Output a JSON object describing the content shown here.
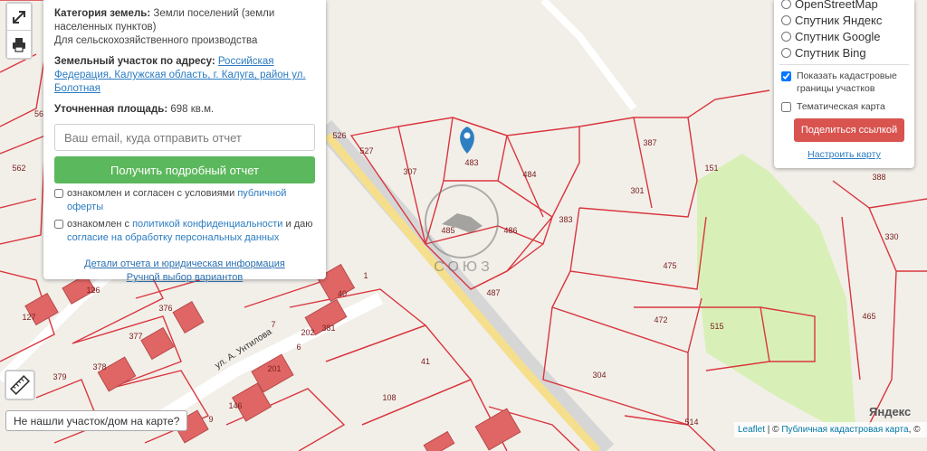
{
  "colors": {
    "parcel_stroke": "#d9363e",
    "building_fill": "#e06666",
    "road_yellow": "#f6df8c",
    "road_grey": "#d6d6d6",
    "green_zone": "#d8f0b8",
    "marker": "#2e7fc2",
    "accent_green": "#5cb85c",
    "accent_red": "#d9534f",
    "link": "#2a7bc1"
  },
  "map_controls": {
    "fullscreen_icon": "expand-icon",
    "print_icon": "printer-icon",
    "ruler_icon": "ruler-icon"
  },
  "info_panel": {
    "category_label": "Категория земель:",
    "category_value": "Земли поселений (земли населенных пунктов)",
    "usage_value": "Для сельскохозяйственного производства",
    "address_label": "Земельный участок по адресу:",
    "address_value": "Российская Федерация, Калужская область, г. Калуга, район ул. Болотная",
    "area_label": "Уточненная площадь:",
    "area_value": "698 кв.м.",
    "email_placeholder": "Ваш email, куда отправить отчет",
    "report_button": "Получить подробный отчет",
    "offer_prefix": "ознакомлен и согласен с условиями",
    "offer_link": "публичной оферты",
    "privacy_prefix": "ознакомлен с",
    "privacy_link": "политикой конфиденциальности",
    "privacy_middle": "и даю",
    "consent_link": "согласие на обработку персональных данных",
    "details_link": "Детали отчета и юридическая информация",
    "manual_link": "Ручной выбор вариантов"
  },
  "layers_panel": {
    "options": [
      {
        "label": "OpenStreetMap",
        "selected": false
      },
      {
        "label": "Спутник Яндекс",
        "selected": false
      },
      {
        "label": "Спутник Google",
        "selected": false
      },
      {
        "label": "Спутник Bing",
        "selected": false
      }
    ],
    "show_boundaries_label": "Показать кадастровые границы участков",
    "show_boundaries_checked": true,
    "thematic_label": "Тематическая карта",
    "thematic_checked": false,
    "share_button": "Поделиться ссылкой",
    "setup_link": "Настроить карту"
  },
  "map": {
    "street_label": "ул. А. Унтилова",
    "watermark_text": "СОЮЗ",
    "parcel_labels": [
      "526",
      "527",
      "307",
      "483",
      "484",
      "485",
      "486",
      "383",
      "387",
      "151",
      "388",
      "301",
      "475",
      "487",
      "472",
      "515",
      "465",
      "330",
      "304",
      "514",
      "41",
      "108",
      "126",
      "127",
      "562",
      "56",
      "379",
      "376",
      "377",
      "378",
      "202",
      "201",
      "40",
      "146",
      "9",
      "1",
      "7",
      "6",
      "381"
    ]
  },
  "footer": {
    "not_found_button": "Не нашли участок/дом на карте?",
    "attribution_leaflet": "Leaflet",
    "attribution_sep": " | © ",
    "attribution_link": "Публичная кадастровая карта",
    "attribution_suffix": ", ©",
    "yandex_logo": "Яндекс"
  }
}
